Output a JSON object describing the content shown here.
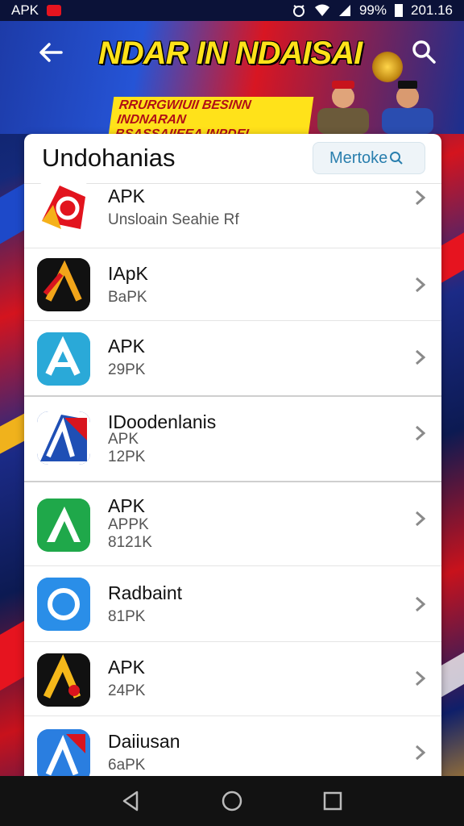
{
  "status_bar": {
    "left_text": "APK",
    "battery": "99%",
    "time": "201.16"
  },
  "header": {
    "banner_title": "NDAR IN NDAISAI",
    "banner_line1": "RRURGWIUII BESINN INDNARAN",
    "banner_line2": "BSASSAIIEEA INPDEI RRADR!"
  },
  "card": {
    "title": "Undohanias",
    "search_label": "Mertoke"
  },
  "apps": [
    {
      "name": "APK",
      "line2": "Unsloain Seahie Rf",
      "line3": "",
      "icon": "red-a-icon"
    },
    {
      "name": "IApK",
      "line2": "BaPK",
      "line3": "",
      "icon": "dark-a-icon"
    },
    {
      "name": "APK",
      "line2": "29PK",
      "line3": "",
      "icon": "cyan-a-icon"
    },
    {
      "name": "IDoodenlanis",
      "line2": "APK",
      "line3": "12PK",
      "icon": "blue-red-a-icon"
    },
    {
      "name": "APK",
      "line2": "APPK",
      "line3": "8121K",
      "icon": "green-a-icon"
    },
    {
      "name": "Radbaint",
      "line2": "81PK",
      "line3": "",
      "icon": "blue-circle-icon"
    },
    {
      "name": "APK",
      "line2": "24PK",
      "line3": "",
      "icon": "black-yellow-a-icon"
    },
    {
      "name": "Daiiusan",
      "line2": "6aPK",
      "line3": "",
      "icon": "blue-red-a2-icon"
    }
  ]
}
